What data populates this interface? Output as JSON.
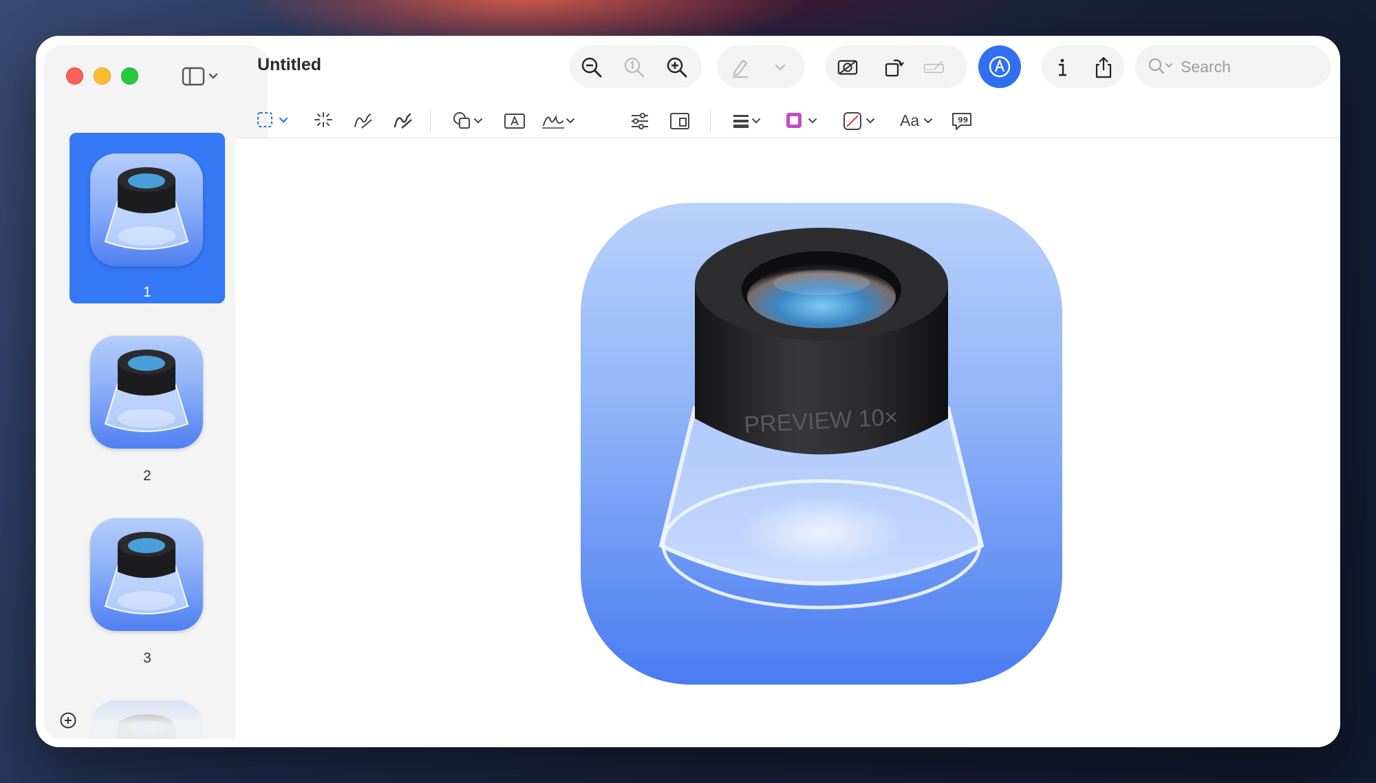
{
  "window": {
    "title": "Untitled"
  },
  "sidebar": {
    "pages": [
      {
        "label": "1",
        "selected": true
      },
      {
        "label": "2",
        "selected": false
      },
      {
        "label": "3",
        "selected": false
      },
      {
        "label": "",
        "selected": false
      }
    ]
  },
  "search": {
    "placeholder": "Search"
  },
  "toolbar": {
    "text_style_label": "Aa"
  },
  "document": {
    "icon_text": "PREVIEW 10×"
  },
  "colors": {
    "accent": "#3478f6",
    "border_color_swatch": "#c44ac9"
  }
}
